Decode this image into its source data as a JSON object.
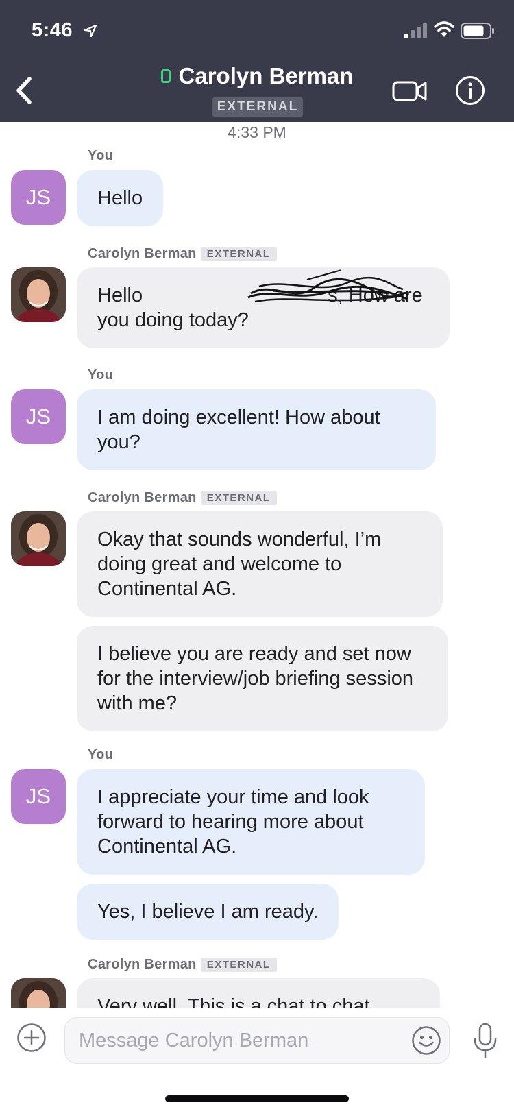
{
  "status_bar": {
    "time": "5:46"
  },
  "header": {
    "contact_name": "Carolyn Berman",
    "external_label": "EXTERNAL",
    "presence_color": "#3ed37a",
    "icons": [
      "back-chevron-icon",
      "video-call-icon",
      "info-icon"
    ]
  },
  "chat": {
    "timestamp": "4:33 PM",
    "you_label": "You",
    "contact_label": "Carolyn Berman",
    "external_badge": "EXTERNAL",
    "my_initials": "JS",
    "my_avatar_color": "#b67ecf",
    "messages": [
      {
        "text": "Hello"
      },
      {
        "text_before": "Hello ",
        "text_after": "s, How are you doing today?",
        "redacted": true
      },
      {
        "text": "I am doing excellent! How about you?"
      },
      {
        "text": "Okay that sounds wonderful, I’m doing great and welcome to Continental AG."
      },
      {
        "text": "I believe you are ready and set now for the interview/job briefing session with me?"
      },
      {
        "text": "I appreciate your time and look forward to hearing more about Continental AG."
      },
      {
        "text": "Yes, I believe I am ready."
      },
      {
        "text": "Very well. This is a chat to chat"
      }
    ]
  },
  "composer": {
    "placeholder": "Message Carolyn Berman",
    "icons": [
      "add-icon",
      "emoji-icon",
      "microphone-icon"
    ]
  }
}
